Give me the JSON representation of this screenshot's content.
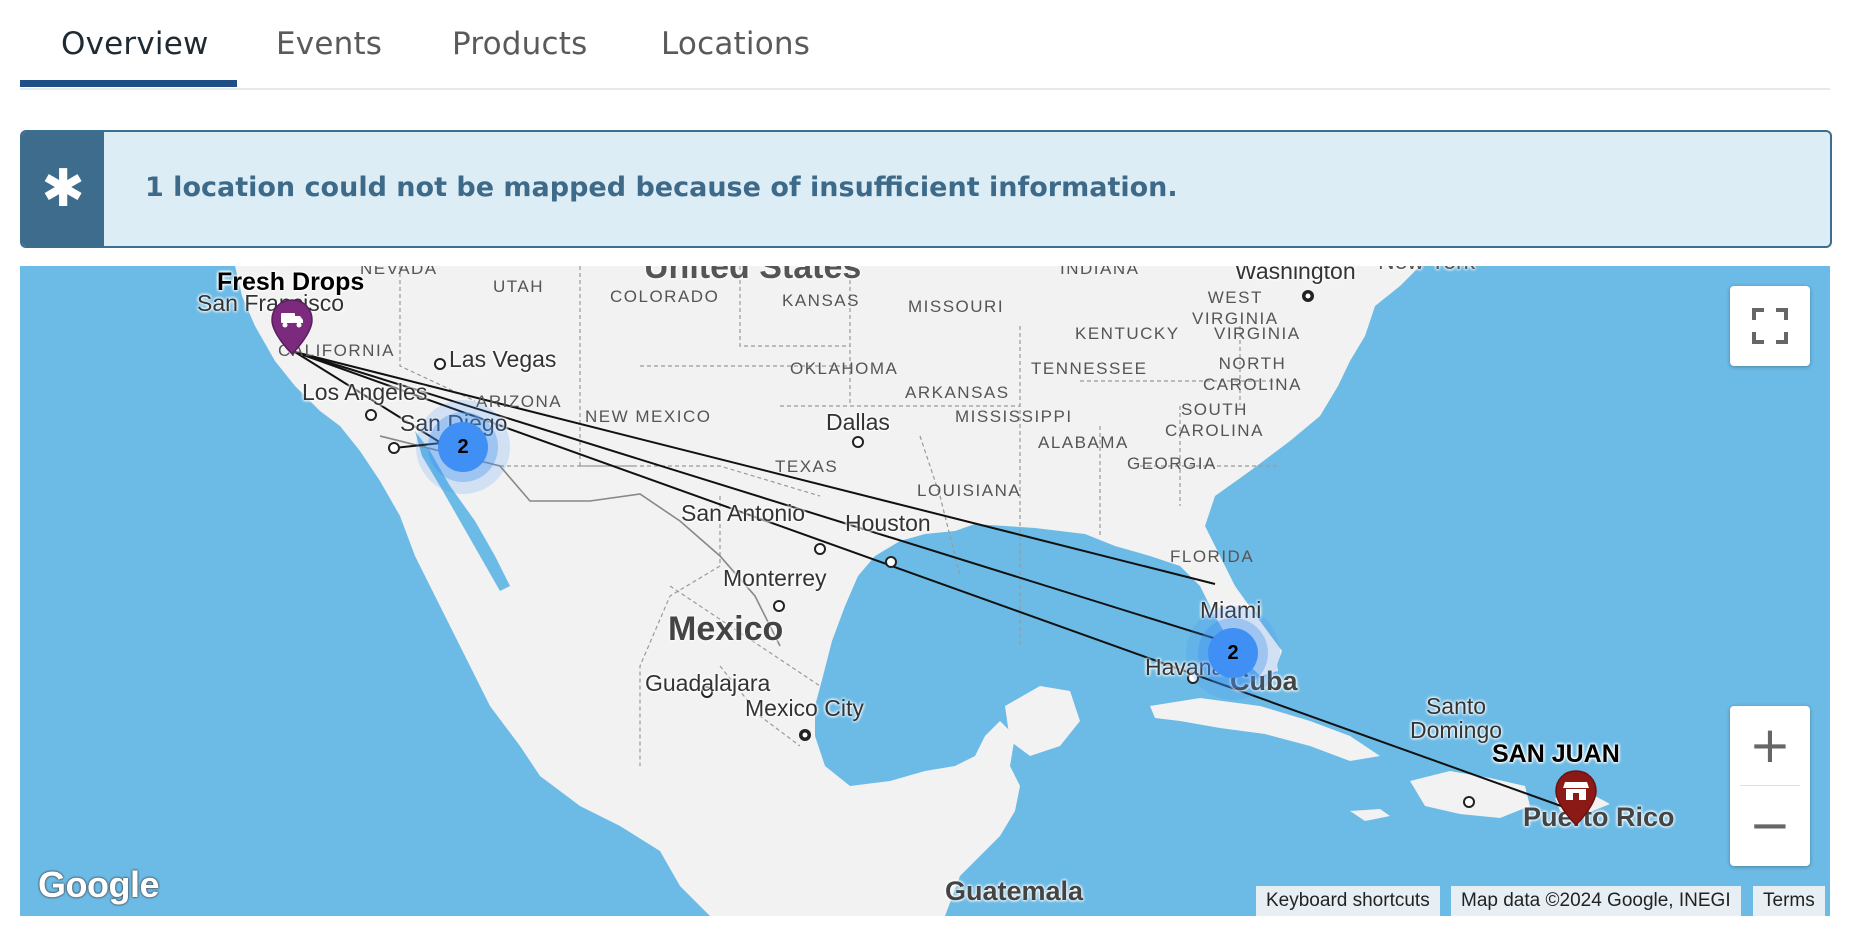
{
  "tabs": [
    {
      "label": "Overview",
      "active": true
    },
    {
      "label": "Events",
      "active": false
    },
    {
      "label": "Products",
      "active": false
    },
    {
      "label": "Locations",
      "active": false
    }
  ],
  "alert": {
    "icon": "asterisk-icon",
    "message": "1 location could not be mapped because of insufficient information."
  },
  "map": {
    "markers": {
      "origin": {
        "title": "Fresh Drops",
        "icon": "truck-icon",
        "color": "#7b2a7e"
      },
      "destination": {
        "title": "SAN JUAN",
        "icon": "store-icon",
        "color": "#8b1a16"
      }
    },
    "clusters": [
      {
        "count": "2",
        "near": "San Diego"
      },
      {
        "count": "2",
        "near": "Miami"
      }
    ],
    "labels": {
      "countries": {
        "us": "United States",
        "mexico": "Mexico",
        "cuba": "Cuba",
        "guatemala": "Guatemala",
        "puerto_rico": "Puerto Rico"
      },
      "states": {
        "nevada": "NEVADA",
        "utah": "UTAH",
        "colorado": "COLORADO",
        "kansas": "KANSAS",
        "missouri": "MISSOURI",
        "indiana": "INDIANA",
        "west_virginia": "WEST\nVIRGINIA",
        "kentucky": "KENTUCKY",
        "virginia": "VIRGINIA",
        "california": "CALIFORNIA",
        "arizona": "ARIZONA",
        "new_mexico": "NEW MEXICO",
        "oklahoma": "OKLAHOMA",
        "arkansas": "ARKANSAS",
        "tennessee": "TENNESSEE",
        "north_carolina": "NORTH\nCAROLINA",
        "south_carolina": "SOUTH\nCAROLINA",
        "mississippi": "MISSISSIPPI",
        "alabama": "ALABAMA",
        "georgia": "GEORGIA",
        "texas": "TEXAS",
        "louisiana": "LOUISIANA",
        "florida": "FLORIDA"
      },
      "cities": {
        "san_francisco": "San Francisco",
        "las_vegas": "Las Vegas",
        "los_angeles": "Los Angeles",
        "san_diego": "San Diego",
        "dallas": "Dallas",
        "san_antonio": "San Antonio",
        "houston": "Houston",
        "monterrey": "Monterrey",
        "guadalajara": "Guadalajara",
        "mexico_city": "Mexico City",
        "havana": "Havana",
        "santo_domingo": "Santo\nDomingo",
        "miami": "Miami",
        "washington": "Washington",
        "new_york": "New York"
      }
    },
    "controls": {
      "fullscreen_icon": "fullscreen-icon",
      "zoom_in": "+",
      "zoom_out": "−"
    },
    "attribution": {
      "logo": "Google",
      "keyboard": "Keyboard shortcuts",
      "data": "Map data ©2024 Google, INEGI",
      "terms": "Terms"
    },
    "colors": {
      "water": "#6cbbe6",
      "land": "#f2f2f2",
      "cluster": "#3f8ff4",
      "route": "#111111"
    }
  }
}
